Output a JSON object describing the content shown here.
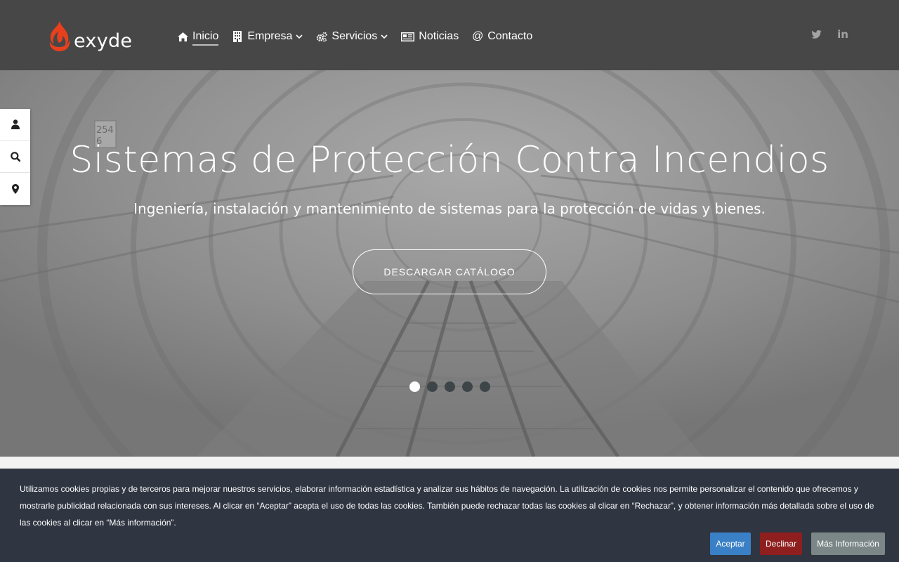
{
  "brand": {
    "name": "exyde",
    "flame_color": "#e8401c"
  },
  "nav": {
    "items": [
      {
        "label": "Inicio",
        "icon": "home-icon",
        "active": true
      },
      {
        "label": "Empresa",
        "icon": "building-icon",
        "dropdown": true
      },
      {
        "label": "Servicios",
        "icon": "cogs-icon",
        "dropdown": true
      },
      {
        "label": "Noticias",
        "icon": "newspaper-icon"
      },
      {
        "label": "Contacto",
        "icon": "at-icon"
      }
    ],
    "at_symbol": "@"
  },
  "social": [
    {
      "icon": "twitter-icon"
    },
    {
      "icon": "linkedin-icon",
      "text": "in"
    }
  ],
  "side_bar": [
    {
      "icon": "user-icon"
    },
    {
      "icon": "search-icon"
    },
    {
      "icon": "map-marker-icon"
    }
  ],
  "hero": {
    "title": "Sistemas de Protección Contra Incendios",
    "subtitle": "Ingeniería, instalación y mantenimiento de sistemas para la protección de vidas y bienes.",
    "button_label": "DESCARGAR CATÁLOGO",
    "slides_total": 5,
    "active_slide": 1,
    "sign_text_1": "254",
    "sign_text_2": "6"
  },
  "cookie": {
    "text": "Utilizamos cookies propias y de terceros para mejorar nuestros servicios, elaborar información estadística y analizar sus hábitos de navegación. La utilización de cookies nos permite personalizar el contenido que ofrecemos y mostrarle publicidad relacionada con sus intereses. Al clicar en “Aceptar” acepta el uso de todas las cookies. También puede rechazar todas las cookies al clicar en “Rechazar”, y obtener información más detallada sobre el uso de las cookies al clicar en “Más información”.",
    "accept_label": "Aceptar",
    "decline_label": "Declinar",
    "more_label": "Más Información",
    "accept_color": "#3a80c6",
    "decline_color": "#8f1e1e",
    "more_color": "#7b8786"
  },
  "colors": {
    "header_bg": "#474747",
    "cookie_bg": "#2f3541",
    "dot_inactive": "#3d4548"
  }
}
